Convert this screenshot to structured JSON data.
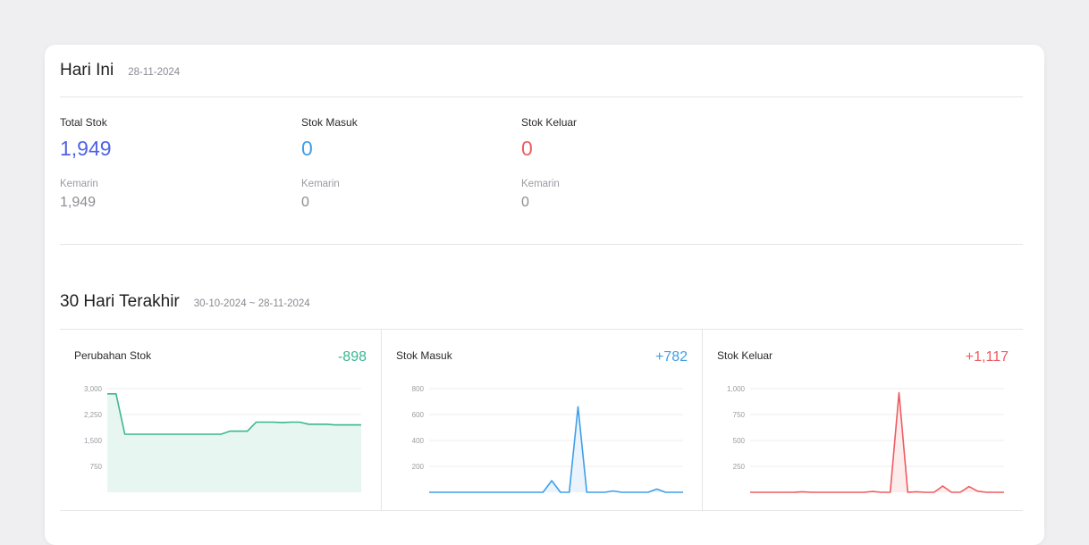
{
  "today": {
    "title": "Hari Ini",
    "date": "28-11-2024",
    "stats": [
      {
        "label": "Total Stok",
        "value": "1,949",
        "prev_label": "Kemarin",
        "prev_value": "1,949",
        "color": "#4f63e7"
      },
      {
        "label": "Stok Masuk",
        "value": "0",
        "prev_label": "Kemarin",
        "prev_value": "0",
        "color": "#3e9fe8"
      },
      {
        "label": "Stok Keluar",
        "value": "0",
        "prev_label": "Kemarin",
        "prev_value": "0",
        "color": "#ee5c61"
      }
    ]
  },
  "last30": {
    "title": "30 Hari Terakhir",
    "range": "30-10-2024 ~ 28-11-2024"
  },
  "chart_data": [
    {
      "type": "area",
      "title": "Perubahan Stok",
      "total": "-898",
      "color": "#39b78f",
      "fill": "#e8f6f1",
      "ylim": [
        0,
        3000
      ],
      "ytick_values": [
        750,
        1500,
        2250,
        3000
      ],
      "yticks": [
        "750",
        "1,500",
        "2,250",
        "3,000"
      ],
      "values": [
        2850,
        2850,
        1680,
        1680,
        1680,
        1680,
        1680,
        1680,
        1680,
        1680,
        1680,
        1680,
        1680,
        1680,
        1770,
        1770,
        1770,
        2030,
        2030,
        2030,
        2020,
        2030,
        2030,
        1970,
        1970,
        1970,
        1950,
        1949,
        1949,
        1949
      ]
    },
    {
      "type": "line",
      "title": "Stok Masuk",
      "total": "+782",
      "color": "#3e9fe8",
      "fill": "#ebf4fc",
      "ylim": [
        0,
        800
      ],
      "ytick_values": [
        200,
        400,
        600,
        800
      ],
      "yticks": [
        "200",
        "400",
        "600",
        "800"
      ],
      "values": [
        0,
        0,
        0,
        0,
        0,
        0,
        0,
        0,
        0,
        0,
        0,
        0,
        0,
        0,
        90,
        0,
        0,
        660,
        0,
        0,
        0,
        10,
        0,
        0,
        0,
        0,
        25,
        0,
        0,
        0
      ]
    },
    {
      "type": "line",
      "title": "Stok Keluar",
      "total": "+1,117",
      "color": "#ee5c61",
      "fill": "#fdecec",
      "ylim": [
        0,
        1000
      ],
      "ytick_values": [
        250,
        500,
        750,
        1000
      ],
      "yticks": [
        "250",
        "500",
        "750",
        "1,000"
      ],
      "values": [
        0,
        0,
        0,
        0,
        0,
        0,
        5,
        0,
        0,
        0,
        0,
        0,
        0,
        0,
        8,
        0,
        0,
        960,
        0,
        5,
        0,
        0,
        60,
        0,
        0,
        55,
        10,
        0,
        0,
        0
      ]
    }
  ]
}
